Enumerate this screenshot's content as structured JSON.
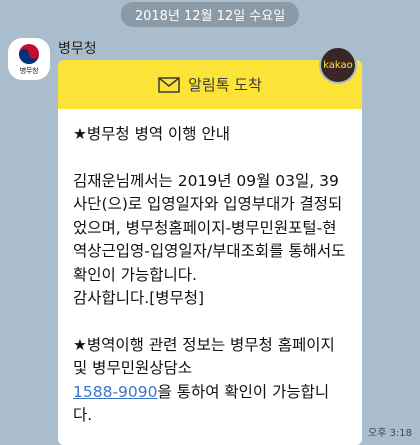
{
  "date_header": "2018년 12월 12일 수요일",
  "sender": {
    "name": "병무청",
    "avatar_label": "병무청"
  },
  "badge": "kakao",
  "message": {
    "header_title": "알림톡 도착",
    "title": "★병무청 병역 이행 안내",
    "paragraph1": "김재운님께서는 2019년 09월 03일, 39사단(으)로 입영일자와 입영부대가 결정되었으며, 병무청홈페이지-병무민원포털-현역상근입영-입영일자/부대조회를 통해서도 확인이 가능합니다.\n감사합니다.[병무청]",
    "paragraph2_pre": "★병역이행 관련 정보는 병무청 홈페이지 및 병무민원상담소",
    "phone": "1588-9090",
    "paragraph2_post": "을 통하여 확인이 가능합니다."
  },
  "timestamp": "오후 3:18",
  "colors": {
    "background": "#a9bdcc",
    "header_yellow": "#fbe437",
    "link_blue": "#3b74c9"
  }
}
